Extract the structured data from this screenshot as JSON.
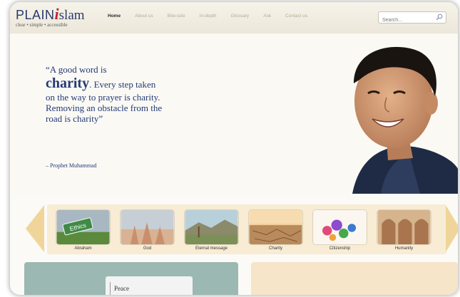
{
  "header": {
    "logo": {
      "brand": "PLAIN",
      "i": "i",
      "islam": "slam",
      "tagline": "clear • simple • accessible"
    },
    "nav": [
      {
        "label": "Home",
        "active": true
      },
      {
        "label": "About us"
      },
      {
        "label": "Bite-size"
      },
      {
        "label": "In-depth"
      },
      {
        "label": "Glossary"
      },
      {
        "label": "Ask"
      },
      {
        "label": "Contact us"
      }
    ],
    "search": {
      "placeholder": "Search..."
    }
  },
  "hero": {
    "quote_open": "“A good word is",
    "quote_big": "charity",
    "quote_rest": ". Every step taken on the way to prayer is charity. Removing an obstacle from the road is charity”",
    "attribution": "– Prophet Muhammad"
  },
  "carousel": {
    "cards": [
      {
        "label": "Abraham",
        "sign": "Ethics"
      },
      {
        "label": "God"
      },
      {
        "label": "Eternal message"
      },
      {
        "label": "Charity"
      },
      {
        "label": "Citizenship"
      },
      {
        "label": "Humanity"
      }
    ]
  },
  "lower": {
    "peace": "Peace"
  },
  "colors": {
    "brand_blue": "#2a3a6e",
    "brand_red": "#c4202e",
    "accent_tan": "#f0d59a",
    "panel_teal": "#9bb8b2"
  }
}
